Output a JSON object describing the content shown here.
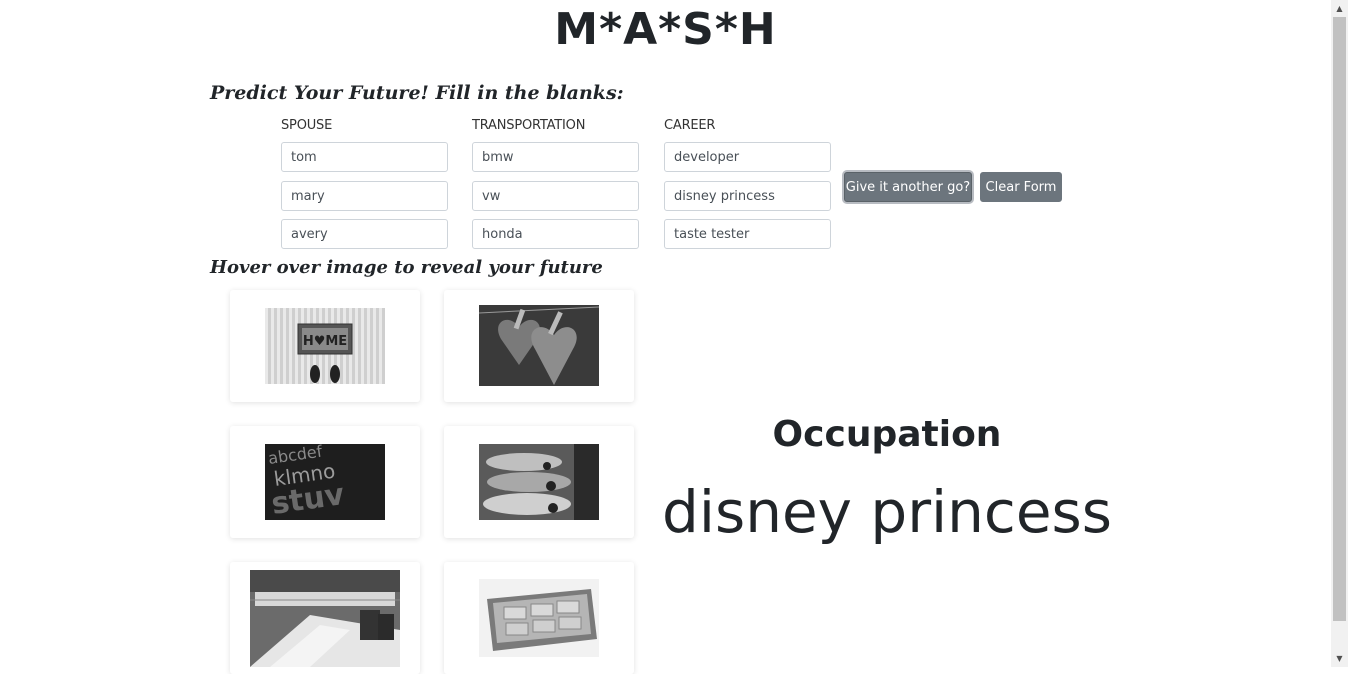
{
  "header": {
    "title": "M*A*S*H",
    "subtitle": "Predict Your Future! Fill in the blanks:"
  },
  "form": {
    "columns": [
      {
        "label": "SPOUSE",
        "values": [
          "tom",
          "mary",
          "avery"
        ]
      },
      {
        "label": "TRANSPORTATION",
        "values": [
          "bmw",
          "vw",
          "honda"
        ]
      },
      {
        "label": "CAREER",
        "values": [
          "developer",
          "disney princess",
          "taste tester"
        ]
      }
    ],
    "retry_label": "Give it another go?",
    "clear_label": "Clear Form"
  },
  "gallery": {
    "hint": "Hover over image to reveal your future",
    "images": [
      "home-doormat-image",
      "hearts-clothespin-image",
      "letter-tiles-image",
      "cars-lot-image",
      "office-interior-image",
      "money-briefcase-image"
    ]
  },
  "result": {
    "label": "Occupation",
    "value": "disney princess"
  },
  "colors": {
    "button": "#6c757d",
    "text": "#212529"
  }
}
